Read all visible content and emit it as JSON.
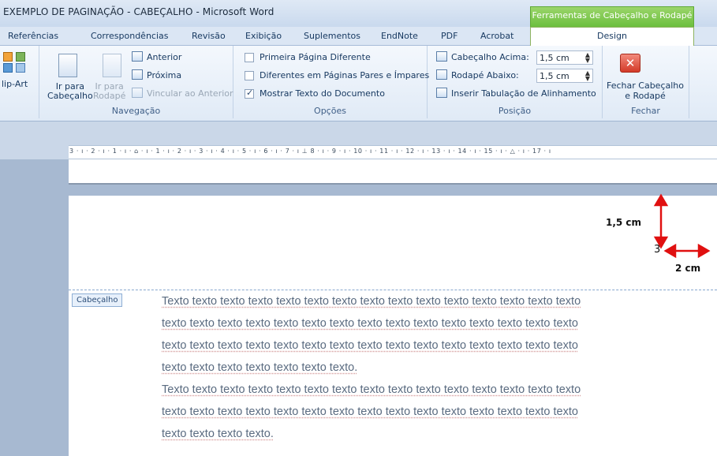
{
  "window": {
    "title": "EXEMPLO DE PAGINAÇÃO - CABEÇALHO - Microsoft Word",
    "context_tab_group": "Ferramentas de Cabeçalho e Rodapé"
  },
  "tabs": [
    "Referências",
    "Correspondências",
    "Revisão",
    "Exibição",
    "Suplementos",
    "EndNote",
    "PDF",
    "Acrobat",
    "Design"
  ],
  "ribbon": {
    "clipart_label": "lip-Art",
    "navigation": {
      "goto_header": "Ir para\nCabeçalho",
      "goto_footer": "Ir para\nRodapé",
      "previous": "Anterior",
      "next": "Próxima",
      "link_previous": "Vincular ao Anterior",
      "group_label": "Navegação"
    },
    "options": {
      "first_page_diff": "Primeira Página Diferente",
      "odd_even_diff": "Diferentes em Páginas Pares e Ímpares",
      "show_doc_text": "Mostrar Texto do Documento",
      "first_page_checked": false,
      "odd_even_checked": false,
      "show_doc_checked": true,
      "group_label": "Opções"
    },
    "position": {
      "header_top_label": "Cabeçalho Acima:",
      "header_top_value": "1,5 cm",
      "footer_bottom_label": "Rodapé Abaixo:",
      "footer_bottom_value": "1,5 cm",
      "insert_tab": "Inserir Tabulação de Alinhamento",
      "group_label": "Posição"
    },
    "close": {
      "close_label": "Fechar Cabeçalho\ne Rodapé",
      "group_label": "Fechar"
    }
  },
  "ruler_text": "3 · ı · 2 · ı · 1 · ı · ⌂ · ı · 1 · ı · 2 · ı · 3 · ı · 4 · ı · 5 · ı · 6 · ı · 7 · ı ⊥ 8 · ı · 9 · ı · 10 · ı · 11 · ı · 12 · ı · 13 · ı · 14 · ı · 15 · ı · △ · ı · 17 · ı",
  "annotations": {
    "vertical_label": "1,5 cm",
    "horizontal_label": "2 cm",
    "page_number": "3",
    "arrow_color": "#e01010"
  },
  "header_tag": "Cabeçalho",
  "body_lines": [
    "Texto texto texto texto texto texto texto texto texto texto texto texto texto texto texto",
    "texto texto texto texto texto texto texto texto texto texto texto texto texto texto texto",
    "texto texto texto texto texto texto texto texto texto texto texto texto texto texto texto",
    "texto texto texto texto texto texto texto.",
    "Texto texto texto texto texto texto texto texto texto texto texto texto texto texto texto",
    "texto texto texto texto texto texto texto texto texto texto texto texto texto texto texto",
    "texto texto texto texto."
  ]
}
